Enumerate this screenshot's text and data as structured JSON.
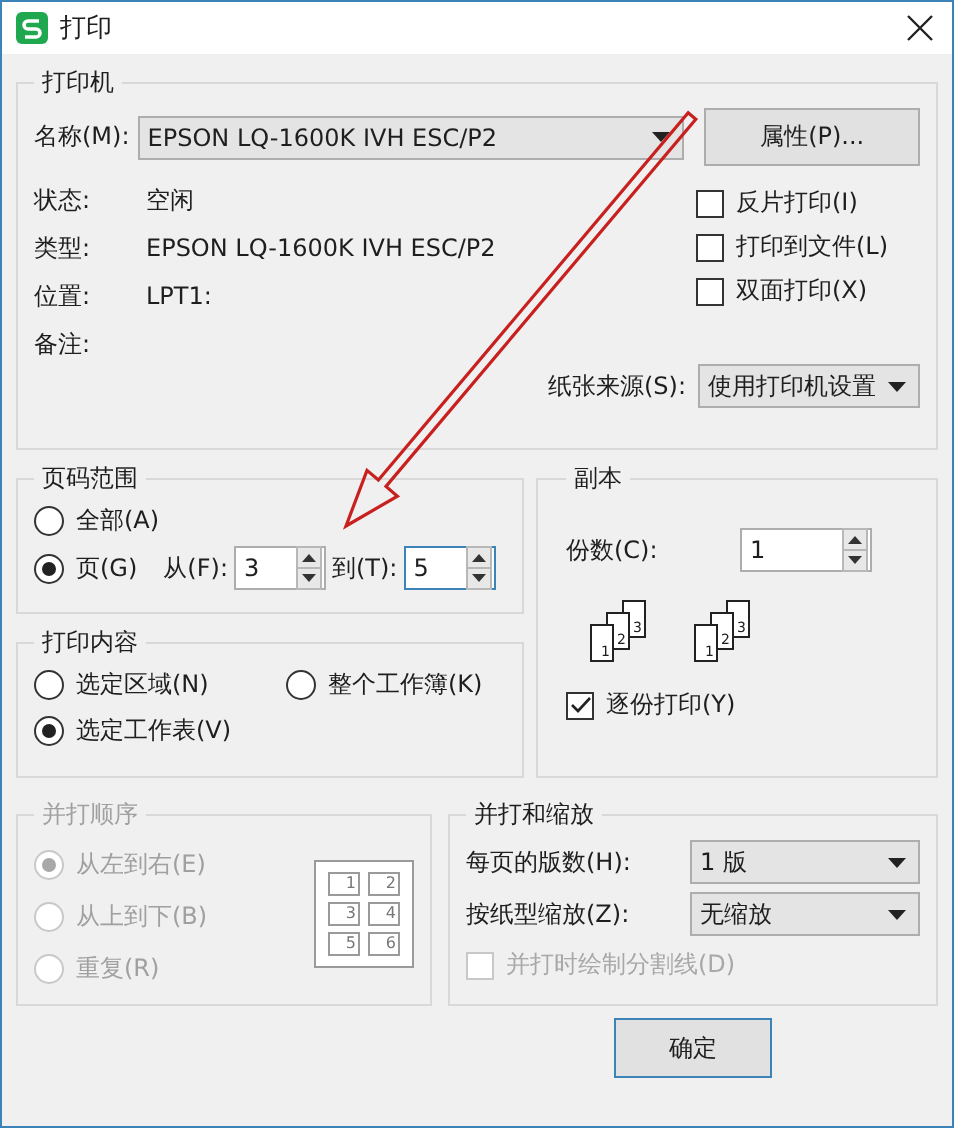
{
  "window": {
    "title": "打印"
  },
  "printer": {
    "legend": "打印机",
    "name_label": "名称(M):",
    "name_value": "EPSON LQ-1600K IVH ESC/P2",
    "properties_button": "属性(P)...",
    "info": [
      {
        "label": "状态:",
        "value": "空闲"
      },
      {
        "label": "类型:",
        "value": "EPSON LQ-1600K IVH ESC/P2"
      },
      {
        "label": "位置:",
        "value": "LPT1:"
      },
      {
        "label": "备注:"
      }
    ],
    "options": [
      {
        "label": "反片打印(I)",
        "checked": false
      },
      {
        "label": "打印到文件(L)",
        "checked": false
      },
      {
        "label": "双面打印(X)",
        "checked": false
      }
    ],
    "paper_source": {
      "label": "纸张来源(S):",
      "value": "使用打印机设置"
    }
  },
  "page_range": {
    "legend": "页码范围",
    "options": [
      {
        "label": "全部(A)",
        "selected": false
      },
      {
        "label": "页(G)",
        "selected": true
      }
    ],
    "from_label": "从(F):",
    "from_value": "3",
    "to_label": "到(T):",
    "to_value": "5",
    "to_focused": true
  },
  "copies": {
    "legend": "副本",
    "count_label": "份数(C):",
    "count_value": "1",
    "stacks": [
      {
        "pages": [
          "1",
          "2",
          "3"
        ]
      },
      {
        "pages": [
          "1",
          "2",
          "3"
        ]
      }
    ],
    "collate": {
      "label": "逐份打印(Y)",
      "checked": true
    }
  },
  "print_content": {
    "legend": "打印内容",
    "options": [
      {
        "label": "选定区域(N)",
        "selected": false
      },
      {
        "label": "整个工作簿(K)",
        "selected": false
      },
      {
        "label": "选定工作表(V)",
        "selected": true
      }
    ]
  },
  "order": {
    "legend": "并打顺序",
    "disabled": true,
    "options": [
      {
        "label": "从左到右(E)",
        "selected": true
      },
      {
        "label": "从上到下(B)",
        "selected": false
      },
      {
        "label": "重复(R)",
        "selected": false
      }
    ],
    "preview": [
      "1",
      "2",
      "3",
      "4",
      "5",
      "6"
    ]
  },
  "scaling": {
    "legend": "并打和缩放",
    "pages_label": "每页的版数(H):",
    "pages_value": "1 版",
    "fit_label": "按纸型缩放(Z):",
    "fit_value": "无缩放",
    "divider": {
      "label": "并打时绘制分割线(D)",
      "checked": false,
      "disabled": true
    }
  },
  "buttons": [
    {
      "label": "确定"
    }
  ]
}
